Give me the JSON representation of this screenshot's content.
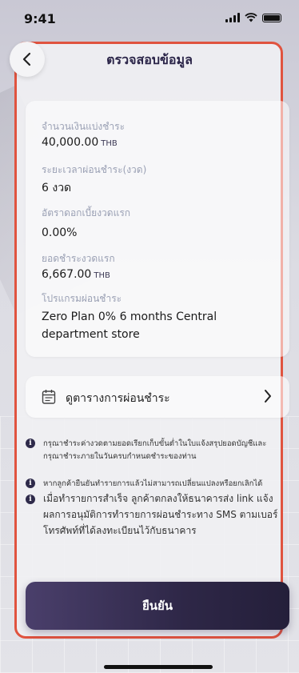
{
  "status_bar": {
    "time": "9:41",
    "icons": [
      "signal-icon",
      "wifi-icon",
      "battery-icon"
    ]
  },
  "header": {
    "title": "ตรวจสอบข้อมูล",
    "back_icon": "chevron-left-icon"
  },
  "summary": {
    "amount_label": "จำนวนเงินแบ่งชำระ",
    "amount_value": "40,000.00",
    "amount_unit": "THB",
    "term_label": "ระยะเวลาผ่อนชำระ(งวด)",
    "term_value": "6 งวด",
    "rate_label": "อัตราดอกเบี้ยงวดแรก",
    "rate_value": "0.00%",
    "first_payment_label": "ยอดชำระงวดแรก",
    "first_payment_value": "6,667.00",
    "first_payment_unit": "THB",
    "plan_label": "โปรแกรมผ่อนชำระ",
    "plan_value": "Zero Plan 0% 6 months Central department store"
  },
  "schedule": {
    "label": "ดูตารางการผ่อนชำระ",
    "icon": "calendar-icon"
  },
  "notes": [
    "กรุณาชำระค่างวดตามยอดเรียกเก็บขั้นต่ำในใบแจ้งสรุปยอดบัญชีและกรุณาชำระภายในวันครบกำหนดชำระของท่าน",
    "หากลูกค้ายืนยันทำรายการแล้วไม่สามารถเปลี่ยนแปลงหรือยกเลิกได้",
    "เมื่อทำรายการสำเร็จ ลูกค้าตกลงให้ธนาคารส่ง link แจ้งผลการอนุมัติการทำรายการผ่อนชำระทาง SMS ตามเบอร์โทรศัพท์ที่ได้ลงทะเบียนไว้กับธนาคาร"
  ],
  "confirm": {
    "label": "ยืนยัน"
  },
  "colors": {
    "accent": "#2e2747",
    "highlight_border": "#e0533f",
    "label": "#9aa0b4"
  }
}
